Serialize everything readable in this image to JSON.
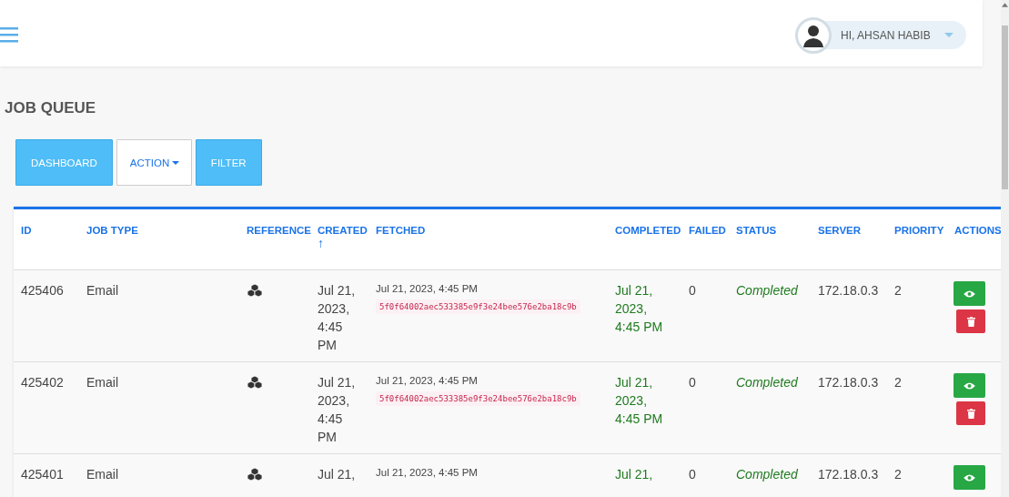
{
  "user_menu": {
    "greeting": "HI, AHSAN HABIB"
  },
  "page_title": "JOB QUEUE",
  "toolbar": [
    {
      "label": "DASHBOARD",
      "kind": "primary"
    },
    {
      "label": "ACTION",
      "kind": "dropdown"
    },
    {
      "label": "FILTER",
      "kind": "primary"
    }
  ],
  "table": {
    "columns": [
      {
        "label": "ID"
      },
      {
        "label": "JOB TYPE"
      },
      {
        "label": "REFERENCE"
      },
      {
        "label": "CREATED",
        "sort": "↑"
      },
      {
        "label": "FETCHED"
      },
      {
        "label": "COMPLETED"
      },
      {
        "label": "FAILED"
      },
      {
        "label": "STATUS"
      },
      {
        "label": "SERVER"
      },
      {
        "label": "PRIORITY"
      },
      {
        "label": "ACTIONS"
      }
    ],
    "rows": [
      {
        "id": "425406",
        "job_type": "Email",
        "created": "Jul 21, 2023, 4:45 PM",
        "fetched": "Jul 21, 2023, 4:45 PM",
        "hash": "5f0f64002aec533385e9f3e24bee576e2ba18c9b",
        "completed": "Jul 21, 2023, 4:45 PM",
        "failed": "0",
        "status": "Completed",
        "server": "172.18.0.3",
        "priority": "2",
        "actions": [
          {
            "kind": "view"
          },
          {
            "kind": "delete"
          }
        ]
      },
      {
        "id": "425402",
        "job_type": "Email",
        "created": "Jul 21, 2023, 4:45 PM",
        "fetched": "Jul 21, 2023, 4:45 PM",
        "hash": "5f0f64002aec533385e9f3e24bee576e2ba18c9b",
        "completed": "Jul 21, 2023, 4:45 PM",
        "failed": "0",
        "status": "Completed",
        "server": "172.18.0.3",
        "priority": "2",
        "actions": [
          {
            "kind": "view"
          },
          {
            "kind": "delete"
          }
        ]
      },
      {
        "id": "425401",
        "job_type": "Email",
        "created": "Jul 21,",
        "fetched": "Jul 21, 2023, 4:45 PM",
        "completed": "Jul 21,",
        "failed": "0",
        "status": "Completed",
        "server": "172.18.0.3",
        "priority": "2",
        "actions": [
          {
            "kind": "view"
          }
        ]
      }
    ]
  }
}
